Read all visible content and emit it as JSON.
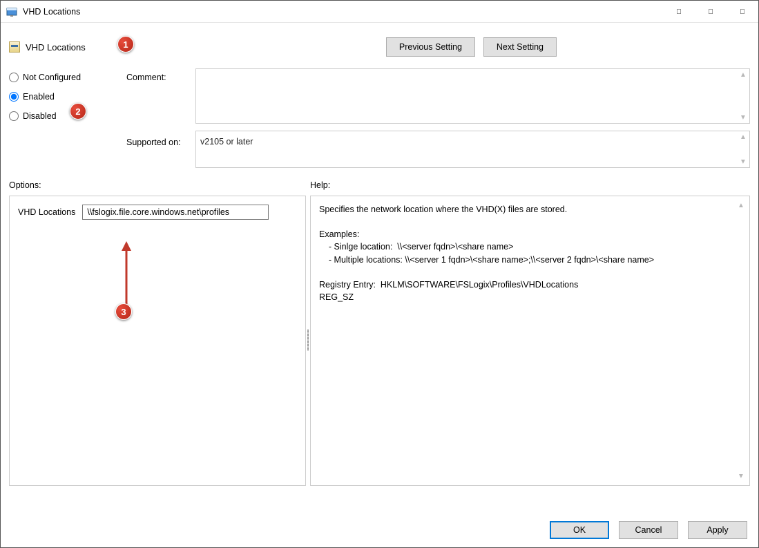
{
  "window": {
    "title": "VHD Locations"
  },
  "header": {
    "policy_title": "VHD Locations",
    "prev_setting": "Previous Setting",
    "next_setting": "Next Setting"
  },
  "state": {
    "not_configured": "Not Configured",
    "enabled": "Enabled",
    "disabled": "Disabled",
    "selected": "enabled"
  },
  "labels": {
    "comment": "Comment:",
    "supported_on": "Supported on:",
    "options": "Options:",
    "help": "Help:"
  },
  "fields": {
    "comment_value": "",
    "supported_on_value": "v2105 or later"
  },
  "options": {
    "vhd_locations_label": "VHD Locations",
    "vhd_locations_value": "\\\\fslogix.file.core.windows.net\\profiles"
  },
  "help": {
    "text": "Specifies the network location where the VHD(X) files are stored.\n\nExamples:\n    - Sinlge location:  \\\\<server fqdn>\\<share name>\n    - Multiple locations: \\\\<server 1 fqdn>\\<share name>;\\\\<server 2 fqdn>\\<share name>\n\nRegistry Entry:  HKLM\\SOFTWARE\\FSLogix\\Profiles\\VHDLocations\nREG_SZ"
  },
  "footer": {
    "ok": "OK",
    "cancel": "Cancel",
    "apply": "Apply"
  },
  "callouts": {
    "c1": "1",
    "c2": "2",
    "c3": "3"
  }
}
